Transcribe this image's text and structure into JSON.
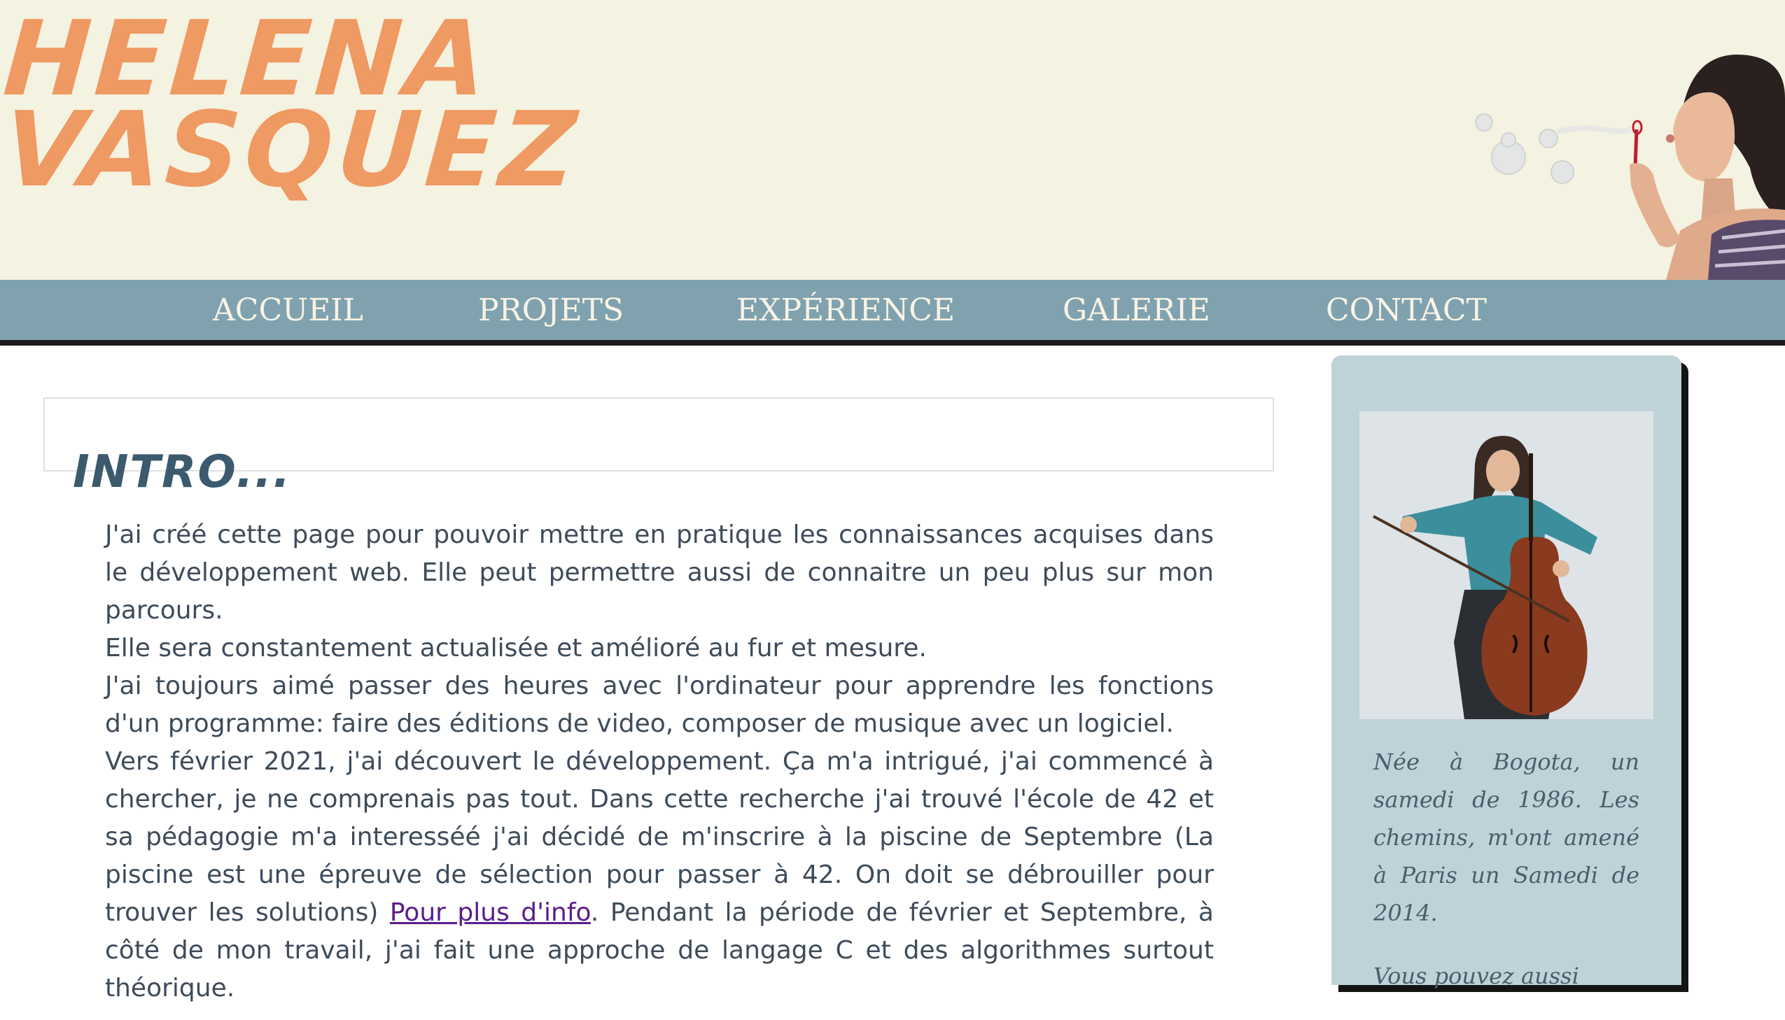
{
  "header": {
    "logo_line1": "HELENA",
    "logo_line2": "VASQUEZ",
    "logo_color": "#ef9963",
    "background": "#f4f2e0"
  },
  "nav": {
    "background": "#80a2ae",
    "items": [
      {
        "label": "ACCUEIL"
      },
      {
        "label": "PROJETS"
      },
      {
        "label": "EXPÉRIENCE"
      },
      {
        "label": "GALERIE"
      },
      {
        "label": "CONTACT"
      }
    ]
  },
  "main": {
    "intro_title": "INTRO...",
    "paragraphs": [
      "J'ai créé cette page pour pouvoir mettre en pratique les connaissances acquises dans le développement web. Elle peut permettre aussi de connaitre un peu plus sur mon parcours.",
      "Elle sera constantement actualisée et amélioré au fur et mesure.",
      "J'ai toujours aimé passer des heures avec l'ordinateur pour apprendre les fonctions d'un programme: faire des éditions de video, composer de musique avec un logiciel."
    ],
    "p4_before": "Vers février 2021, j'ai découvert le développement. Ça m'a intrigué, j'ai commencé à chercher, je ne comprenais pas tout. Dans cette recherche j'ai trouvé l'école de 42 et sa pédagogie m'a interesséé j'ai décidé de m'inscrire à la piscine de Septembre (La piscine est une épreuve de sélection pour passer à 42. On doit se débrouiller pour trouver les solutions) ",
    "p4_link": "Pour plus d'info",
    "p4_after": ". Pendant la période de février et Septembre, à côté de mon travail, j'ai fait une approche de langage C et des algorithmes surtout théorique."
  },
  "sidebar": {
    "bio": "Née à Bogota, un samedi de 1986. Les chemins, m'ont amené à Paris un Samedi de 2014.",
    "more": "Vous pouvez aussi"
  }
}
